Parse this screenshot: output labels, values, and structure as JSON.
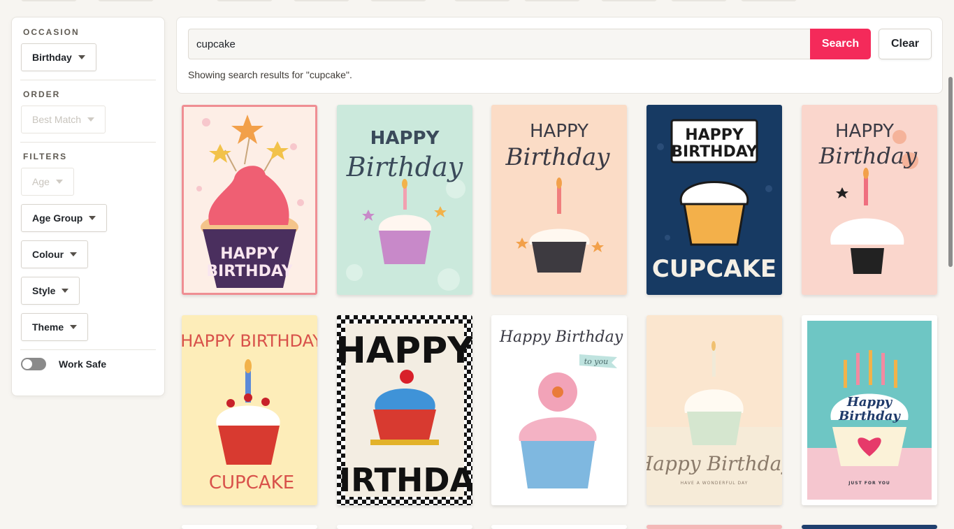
{
  "sidebar": {
    "occasion": {
      "title": "OCCASION",
      "value": "Birthday"
    },
    "order": {
      "title": "ORDER",
      "value": "Best Match"
    },
    "filters": {
      "title": "FILTERS",
      "items": [
        "Age",
        "Age Group",
        "Colour",
        "Style",
        "Theme"
      ]
    },
    "work_safe": {
      "label": "Work Safe",
      "enabled": false
    }
  },
  "search": {
    "query": "cupcake",
    "button": "Search",
    "clear": "Clear",
    "result_text": "Showing search results for \"cupcake\"."
  },
  "cards": [
    {
      "line1": "HAPPY",
      "line2": "BIRTHDAY",
      "bg": "#fdeee6"
    },
    {
      "line1": "HAPPY",
      "line2": "Birthday",
      "bg": "#cbe9dc"
    },
    {
      "line1": "HAPPY",
      "line2": "Birthday",
      "bg": "#fbdcc6"
    },
    {
      "line1": "HAPPY",
      "line2": "BIRTHDAY",
      "line3": "CUPCAKE",
      "bg": "#173a63"
    },
    {
      "line1": "HAPPY",
      "line2": "Birthday",
      "bg": "#fad6cc"
    },
    {
      "line1": "HAPPY BIRTHDAY",
      "line2": "CUPCAKE",
      "bg": "#fdedb9"
    },
    {
      "line1": "HAPPY",
      "line2": "BIRTHDAY",
      "bg": "#f3ede2"
    },
    {
      "line1": "Happy Birthday",
      "line2": "to you",
      "bg": "#ffffff"
    },
    {
      "line1": "Happy Birthday",
      "line2": "HAVE A WONDERFUL DAY",
      "bg": "#fbe6cf"
    },
    {
      "line1": "Happy",
      "line2": "Birthday",
      "line3": "JUST FOR YOU",
      "bg": "#6ec6c4"
    }
  ],
  "colors": {
    "accent": "#f42a5a",
    "background": "#f7f5f1"
  }
}
